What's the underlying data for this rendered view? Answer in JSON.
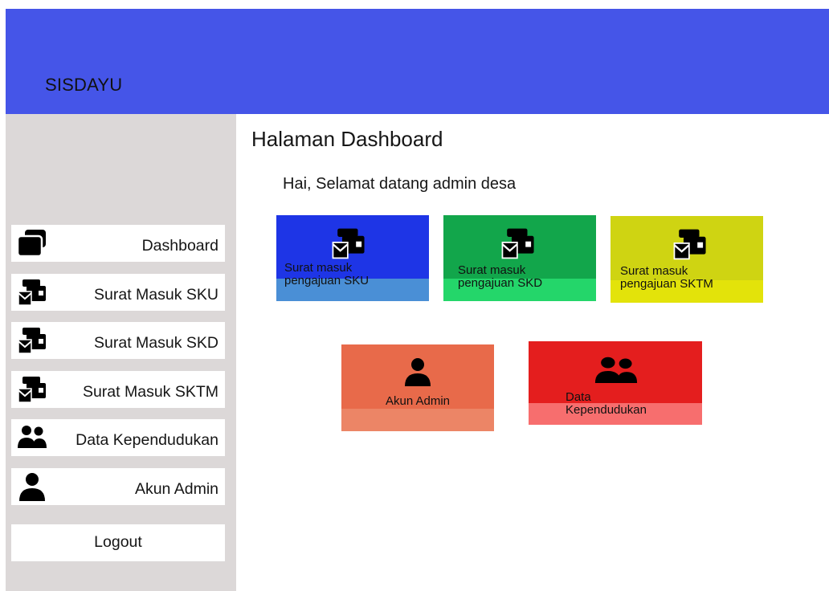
{
  "app": {
    "title": "SISDAYU"
  },
  "sidebar": {
    "items": [
      {
        "label": "Dashboard",
        "icon": "dashboard-icon"
      },
      {
        "label": "Surat Masuk SKU",
        "icon": "mail-wallet-icon"
      },
      {
        "label": "Surat Masuk SKD",
        "icon": "mail-wallet-icon"
      },
      {
        "label": "Surat Masuk SKTM",
        "icon": "mail-wallet-icon"
      },
      {
        "label": "Data Kependudukan",
        "icon": "users-icon"
      },
      {
        "label": "Akun Admin",
        "icon": "user-icon"
      }
    ],
    "logout": "Logout"
  },
  "main": {
    "title": "Halaman Dashboard",
    "welcome": "Hai, Selamat datang admin desa",
    "cards": [
      {
        "line1": "Surat masuk",
        "line2": "pengajuan SKU",
        "icon": "mail-wallet-icon",
        "color": "#1e35e6",
        "band": "#4a8fd6"
      },
      {
        "line1": "Surat masuk",
        "line2": "pengajuan SKD",
        "icon": "mail-wallet-icon",
        "color": "#12a64b",
        "band": "#24d66a"
      },
      {
        "line1": "Surat masuk",
        "line2": "pengajuan SKTM",
        "icon": "mail-wallet-icon",
        "color": "#cfd412",
        "band": "#e3e30a"
      },
      {
        "line1": "Akun Admin",
        "icon": "user-icon",
        "color": "#e86a4a",
        "band": "#ec8566"
      },
      {
        "line1": "Data",
        "line2": "Kependudukan",
        "icon": "users-icon",
        "color": "#e41e1e",
        "band": "#f76e6e"
      }
    ]
  }
}
